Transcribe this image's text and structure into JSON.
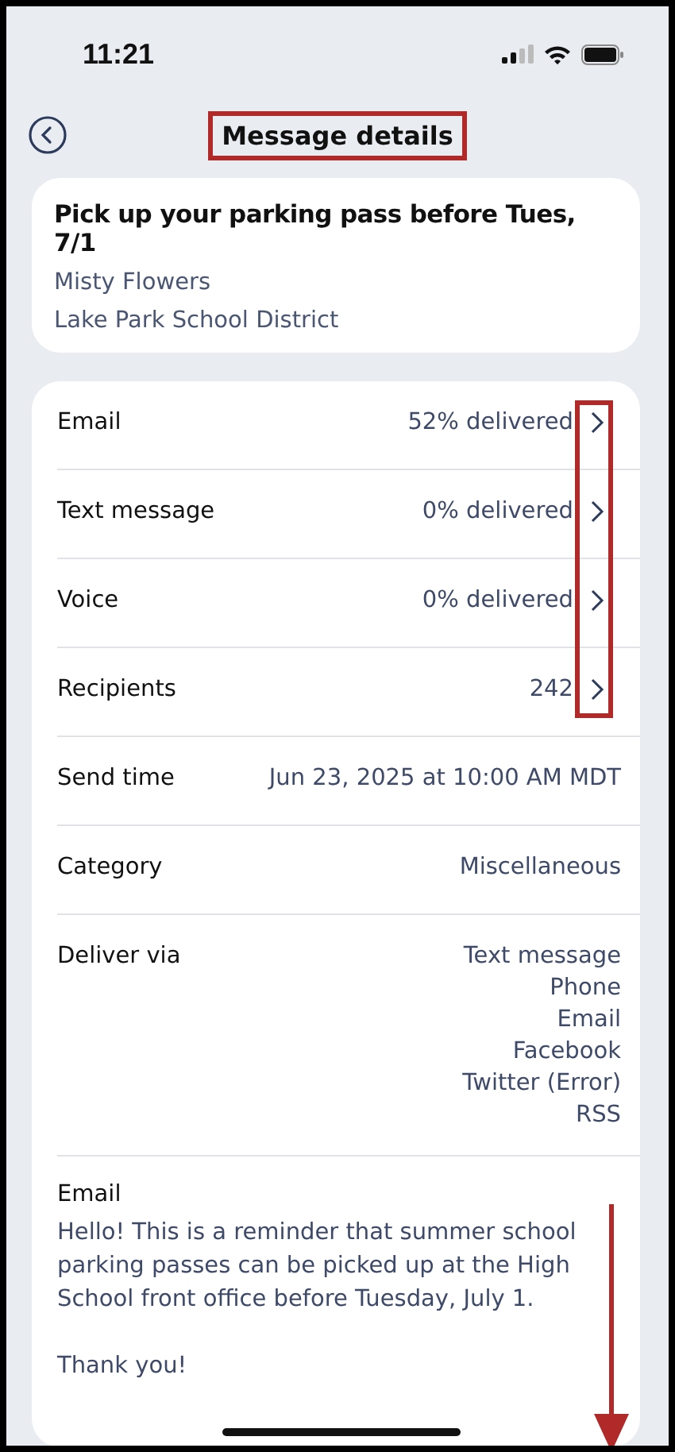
{
  "status_bar": {
    "time": "11:21"
  },
  "header": {
    "title": "Message details"
  },
  "summary": {
    "subject": "Pick up your parking pass before Tues, 7/1",
    "sender": "Misty Flowers",
    "organization": "Lake Park School District"
  },
  "details": [
    {
      "kind": "link",
      "label": "Email",
      "values": [
        "52% delivered"
      ]
    },
    {
      "kind": "link",
      "label": "Text message",
      "values": [
        "0% delivered"
      ]
    },
    {
      "kind": "link",
      "label": "Voice",
      "values": [
        "0% delivered"
      ]
    },
    {
      "kind": "link",
      "label": "Recipients",
      "values": [
        "242"
      ]
    },
    {
      "kind": "info",
      "label": "Send time",
      "values": [
        "Jun 23, 2025 at 10:00 AM MDT"
      ]
    },
    {
      "kind": "info",
      "label": "Category",
      "values": [
        "Miscellaneous"
      ]
    },
    {
      "kind": "info",
      "label": "Deliver via",
      "values": [
        "Text message",
        "Phone",
        "Email",
        "Facebook",
        "Twitter (Error)",
        "RSS"
      ]
    }
  ],
  "message": {
    "label": "Email",
    "paragraphs": [
      "Hello! This is a reminder that summer school parking passes can be picked up at the High School front office before Tuesday, July 1.",
      "Thank you!"
    ]
  }
}
